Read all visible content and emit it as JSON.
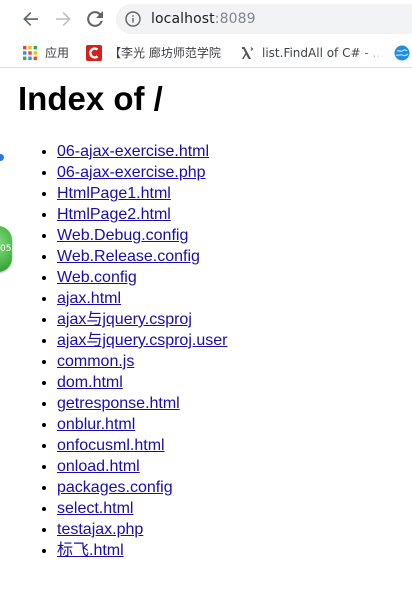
{
  "browser": {
    "url_host": "localhost",
    "url_port": ":8089",
    "bookmarks": [
      {
        "label": "应用",
        "icon": "apps-grid-icon"
      },
      {
        "label": "【李光 廊坊师范学院",
        "icon": "red-c-favicon"
      },
      {
        "label": "list.FindAll of C# - ...",
        "icon": "lambda-favicon"
      },
      {
        "label": "",
        "icon": "globe-favicon"
      }
    ]
  },
  "page": {
    "title": "Index of /",
    "files": [
      "06-ajax-exercise.html",
      "06-ajax-exercise.php",
      "HtmlPage1.html",
      "HtmlPage2.html",
      "Web.Debug.config",
      "Web.Release.config",
      "Web.config",
      "ajax.html",
      "ajax与jquery.csproj",
      "ajax与jquery.csproj.user",
      "common.js",
      "dom.html",
      "getresponse.html",
      "onblur.html",
      "onfocusml.html",
      "onload.html",
      "packages.config",
      "select.html",
      "testajax.php",
      "标飞.html"
    ],
    "side_badge_text": "05"
  },
  "colors": {
    "link": "#1a0dab",
    "omnibox_bg": "#f1f3f4",
    "toolbar_icon": "#5f6368",
    "forward_disabled": "#bdc1c6"
  }
}
